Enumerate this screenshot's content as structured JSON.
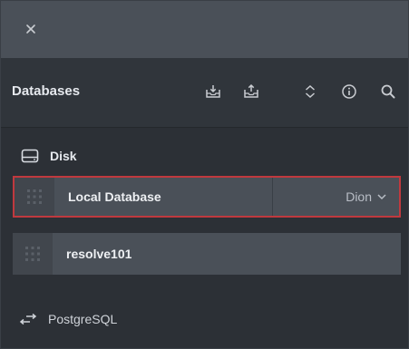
{
  "window": {
    "close_icon": "close-icon"
  },
  "toolbar": {
    "title": "Databases",
    "icons": [
      "import-database-icon",
      "export-database-icon",
      "sort-icon",
      "info-icon",
      "search-icon"
    ]
  },
  "section": {
    "label": "Disk",
    "icon": "disk-icon"
  },
  "databases": [
    {
      "name": "Local Database",
      "user": "Dion",
      "selected": true
    },
    {
      "name": "resolve101",
      "user": "",
      "selected": false
    }
  ],
  "footer": {
    "label": "PostgreSQL",
    "icon": "switch-arrows-icon"
  },
  "colors": {
    "selection_border": "#c0393e",
    "row_background": "#4a5058",
    "panel_background": "#2c3036"
  }
}
